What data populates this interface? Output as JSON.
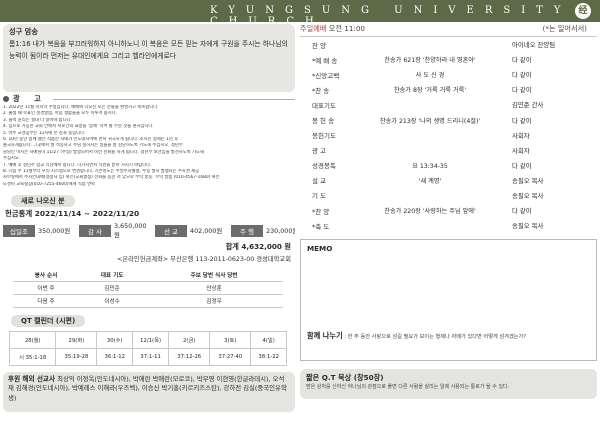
{
  "header": {
    "title": "KYUNGSUNG UNIVERSITY CHURCH",
    "logo": "经"
  },
  "verse": {
    "title": "성구 암송",
    "text": "롬1:16 내가 복음을 부끄러워하지 아니하노니 이 복음은 모든 믿는 자에게 구원을 주시는 하나님의 능력이 됨이라 먼저는 유대인에게요 그리고 헬라인에게로다"
  },
  "notices": {
    "title": "광 고",
    "items": [
      "1. 2022년 11월 마지막 주일입니다. 예배에 나오신 모든 분들을 환영하고 축복합니다.",
      "2. 출생 때 목표인 성경말씀, 마음 생활들을 모두 이루어 봅시다.",
      "3. 블랙 윤리는 절대 다 알아야 합니다.",
      "4. 임으로 가능한 교회 안에서 서로간의 표정을 '함께' 지켜 볼 부분 것을 원하십니다.",
      "5. 아주 교경공부는 11시에 본 강좌 중입니다.",
      "6. 10년 동안 함께 했던 작품한 자매가 인도네시아에 먼저 귀국하게 됩니다. 조시진 형제는 1년 후",
      "   졸국하게됩니다. 그곳에서 잘 적응하고 주님 정하시는 일들을 잘 감당하도록 기도해 주십시오. 청년부",
      "   담당인 이지은 자매님이 11/27 (주일) 발열되어서 비전 헌회를 하게 됩니다. 청년부 보전임을 발견하도록 기도해",
      "   주십시오.",
      "7. 예배 후 청년주 함교 식당에서 합니다. 나가시면서 식권을 받아 가시기 바랍니다.",
      "8. 다음 주 11월부터 우리 시스템으로 변경합니다. 기존성도는 주일주차월행, 주일 필시 발행자는 주차권 제공",
      "   사무실에서 주차안내에(결정사 입) 혹은(교회행정) 전화를 통한 저 있으로 부탁 송듯. 부탁 말씀 (010-4567-1680) 혹은",
      "   노경미 교육실장(010-7255-4600)에게 직접 연락"
    ]
  },
  "newfamily": {
    "title": "새로 나오신 분"
  },
  "offering": {
    "title": "헌금통계 2022/11/14 ~ 2022/11/20",
    "items": [
      {
        "label": "십일조",
        "amount": "350,000원"
      },
      {
        "label": "감 사",
        "amount": "3,650,000원"
      },
      {
        "label": "선 교",
        "amount": "402,000원"
      },
      {
        "label": "주 행",
        "amount": "230,000원"
      }
    ],
    "total": "합계 4,632,000 원",
    "bank": "<온라인헌금계좌> 부산은행 113-2011-0623-00 경성대학교회"
  },
  "duty": {
    "headers": [
      "봉사 순서",
      "대표 기도",
      "주보 당번 식사 당번"
    ],
    "rows": [
      [
        "이번 주",
        "김민준",
        "안상훈"
      ],
      [
        "다음 주",
        "이성수",
        "김정우"
      ]
    ]
  },
  "qt_calendar": {
    "title": "QT 캘린더 (시편)",
    "days": [
      "28(월)",
      "29(화)",
      "30(수)",
      "12/1(목)",
      "2(금)",
      "3(토)",
      "4(일)"
    ],
    "passages": [
      "시 35:1-18",
      "35:19-28",
      "36:1-12",
      "37:1-11",
      "37:12-26",
      "37:27-40",
      "38:1-22"
    ]
  },
  "mission": {
    "label": "후원 해외 선교사",
    "text": "최상익 이정옥(인도네시아), 박애란 박애란(모로코), 박무영 이현영(한글라데시), 오석재 김해경(인도네시아), 박예례스 이해라(우즈벡), 이승신 박기홍(키르키즈스탄), 강하전 김실(중국인유학생)"
  },
  "service": {
    "title": "주일예배",
    "time": "오전 11:00",
    "note": "(*는 일어서서)",
    "order": [
      {
        "name": "찬 양",
        "content": "",
        "leader": "아이네오 찬양팀"
      },
      {
        "name": "*예 배 송",
        "content": "찬송가 621장 '찬양하라 내 영혼아'",
        "leader": "다 같이"
      },
      {
        "name": "*신앙고백",
        "content": "사 도 신 경",
        "leader": "다 같이"
      },
      {
        "name": "*찬 송",
        "content": "찬송가 8장 '거룩 거룩 거룩'",
        "leader": "다 같이"
      },
      {
        "name": "대표기도",
        "content": "",
        "leader": "김민준 간사"
      },
      {
        "name": "봉 헌 송",
        "content": "찬송가 213장 '나의 생명 드리니(4절)'",
        "leader": "다 같이"
      },
      {
        "name": "봉헌기도",
        "content": "",
        "leader": "사회자"
      },
      {
        "name": "광 고",
        "content": "",
        "leader": "사회자"
      },
      {
        "name": "성경봉독",
        "content": "요 13:34-35",
        "leader": "다 같이"
      },
      {
        "name": "설 교",
        "content": "'새 계명'",
        "leader": "송필오 목사"
      },
      {
        "name": "기 도",
        "content": "",
        "leader": "송필오 목사"
      },
      {
        "name": "*찬 양",
        "content": "찬송가 220장 '사랑하는 주님 앞에'",
        "leader": "다 같이"
      },
      {
        "name": "*축 도",
        "content": "",
        "leader": "송필오 목사"
      }
    ]
  },
  "memo": {
    "title": "MEMO",
    "share_title": "함께 나누기",
    "share_text": ": 한 주 동안 사랑으로 섬길 필요가 보이는 형제나 자매가 있다면 어떻게 섬겨겠는가?"
  },
  "qt_meditation": {
    "title": "짧은 Q.T 묵상 (창50장)",
    "text": "받은 상처를 신하신 하나님의 관점으로 풀면 다른 사람을 살리는 일에 사용되는 통로가 될 수 있다."
  },
  "colors": {
    "topbar": "#5d6a48",
    "accent_red": "#b4424b",
    "box_bg": "#e4e5e1"
  }
}
